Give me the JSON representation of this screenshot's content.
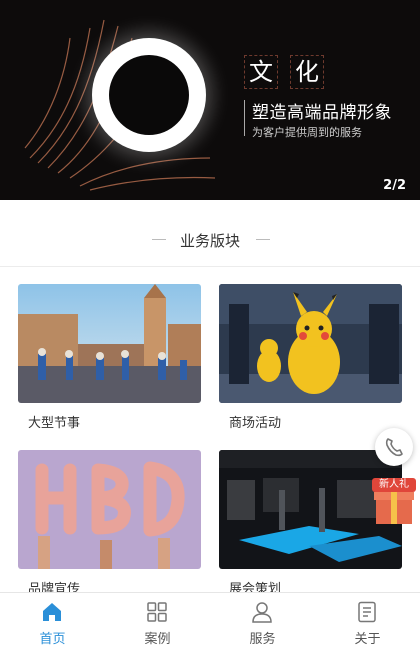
{
  "banner": {
    "char1": "文",
    "char2": "化",
    "title": "塑造高端品牌形象",
    "subtitle": "为客户提供周到的服务",
    "pager": "2/2"
  },
  "section": {
    "title": "业务版块"
  },
  "cards": [
    {
      "label": "大型节事"
    },
    {
      "label": "商场活动"
    },
    {
      "label": "品牌宣传"
    },
    {
      "label": "展会策划"
    }
  ],
  "gift": {
    "label": "新人礼"
  },
  "tabs": [
    {
      "label": "首页",
      "icon": "home-icon",
      "active": true
    },
    {
      "label": "案例",
      "icon": "grid-icon",
      "active": false
    },
    {
      "label": "服务",
      "icon": "user-icon",
      "active": false
    },
    {
      "label": "关于",
      "icon": "document-icon",
      "active": false
    }
  ],
  "colors": {
    "accent": "#2a8fd8",
    "banner_bg": "#0d0b0b",
    "gift_red": "#e0463a"
  }
}
